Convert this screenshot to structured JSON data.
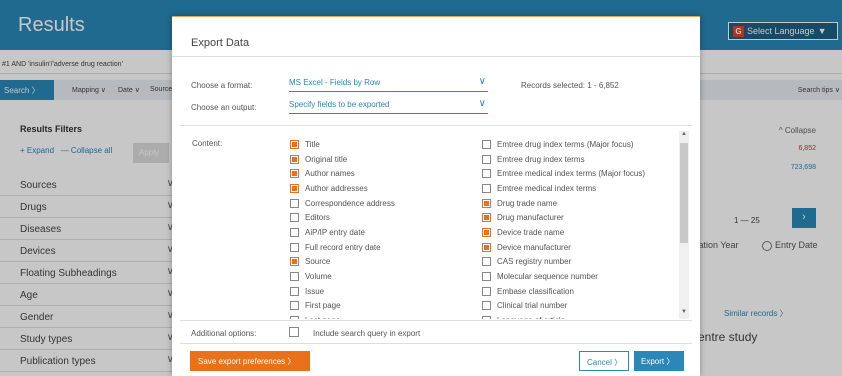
{
  "page": {
    "title": "Results",
    "language_label": "Select Language",
    "query": "#1 AND 'insulin'/'adverse drug reaction'",
    "tabs": {
      "search": "Search",
      "mapping": "Mapping",
      "date": "Date",
      "sources": "Source"
    },
    "search_tips": "Search tips",
    "filters": {
      "heading": "Results Filters",
      "expand": "+ Expand",
      "collapse_all": "— Collapse all",
      "apply": "Apply",
      "items": [
        "Sources",
        "Drugs",
        "Diseases",
        "Devices",
        "Floating Subheadings",
        "Age",
        "Gender",
        "Study types",
        "Publication types"
      ]
    },
    "right": {
      "collapse": "^ Collapse",
      "count1": "6,852",
      "count2": "723,698",
      "pagination": "1 — 25",
      "pub_year": "lication Year",
      "entry_date": "Entry Date",
      "similar": "Similar records",
      "centre": "centre study"
    }
  },
  "modal": {
    "title": "Export Data",
    "format_label": "Choose a format:",
    "format_value": "MS Excel - Fields by Row",
    "output_label": "Choose an output:",
    "output_value": "Specify fields to be exported",
    "records": "Records selected: 1 - 6,852",
    "content_label": "Content:",
    "left_fields": [
      {
        "label": "Title",
        "checked": true
      },
      {
        "label": "Original title",
        "checked": true
      },
      {
        "label": "Author names",
        "checked": true
      },
      {
        "label": "Author addresses",
        "checked": true
      },
      {
        "label": "Correspondence address",
        "checked": false
      },
      {
        "label": "Editors",
        "checked": false
      },
      {
        "label": "AiP/IP entry date",
        "checked": false
      },
      {
        "label": "Full record entry date",
        "checked": false
      },
      {
        "label": "Source",
        "checked": true
      },
      {
        "label": "Volume",
        "checked": false
      },
      {
        "label": "Issue",
        "checked": false
      },
      {
        "label": "First page",
        "checked": false
      },
      {
        "label": "Last page",
        "checked": false
      }
    ],
    "right_fields": [
      {
        "label": "Emtree drug index terms (Major focus)",
        "checked": false
      },
      {
        "label": "Emtree drug index terms",
        "checked": false
      },
      {
        "label": "Emtree medical index terms (Major focus)",
        "checked": false
      },
      {
        "label": "Emtree medical index terms",
        "checked": false
      },
      {
        "label": "Drug trade name",
        "checked": true
      },
      {
        "label": "Drug manufacturer",
        "checked": true
      },
      {
        "label": "Device trade name",
        "checked": true
      },
      {
        "label": "Device manufacturer",
        "checked": true
      },
      {
        "label": "CAS registry number",
        "checked": false
      },
      {
        "label": "Molecular sequence number",
        "checked": false
      },
      {
        "label": "Embase classification",
        "checked": false
      },
      {
        "label": "Clinical trial number",
        "checked": false
      },
      {
        "label": "Language of article",
        "checked": false
      }
    ],
    "additional_label": "Additional options:",
    "include_query": "Include search query in export",
    "save_btn": "Save export preferences",
    "cancel_btn": "Cancel",
    "export_btn": "Export"
  }
}
